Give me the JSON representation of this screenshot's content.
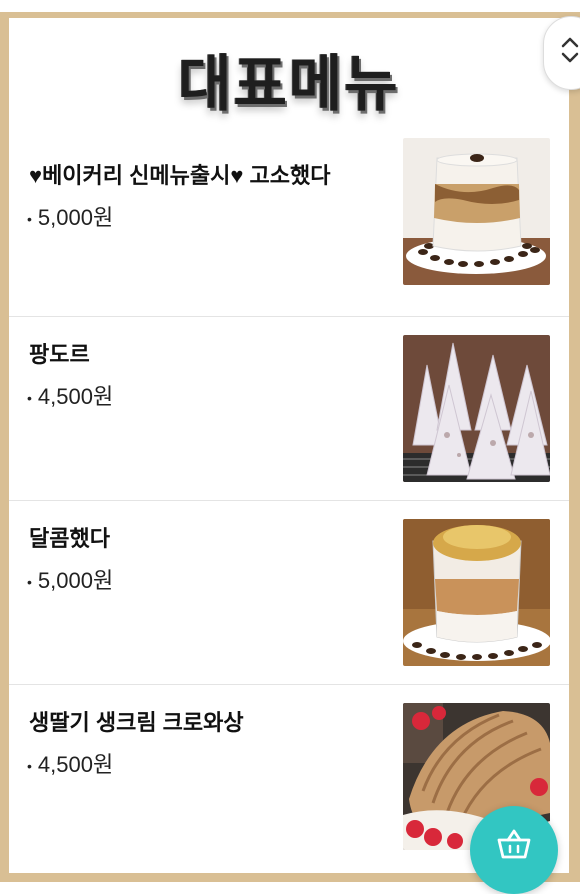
{
  "header": {
    "title": "대표메뉴"
  },
  "menu": [
    {
      "name": "♥베이커리 신메뉴출시♥ 고소했다",
      "price": "5,000원",
      "bullet": "•",
      "image": "iced-latte-with-coffee-beans"
    },
    {
      "name": "팡도르",
      "price": "4,500원",
      "bullet": "•",
      "image": "powdered-pandoro-breads"
    },
    {
      "name": "달콤했다",
      "price": "5,000원",
      "bullet": "•",
      "image": "dalgona-latte-with-coffee-beans"
    },
    {
      "name": "생딸기 생크림 크로와상",
      "price": "4,500원",
      "bullet": "•",
      "image": "strawberry-cream-croissant"
    }
  ],
  "controls": {
    "scroll_icon": "up-down-chevron-icon",
    "cart_icon": "shopping-basket-icon"
  },
  "colors": {
    "frame": "#d9bf94",
    "cart_button": "#32c6c2",
    "text": "#111111"
  }
}
